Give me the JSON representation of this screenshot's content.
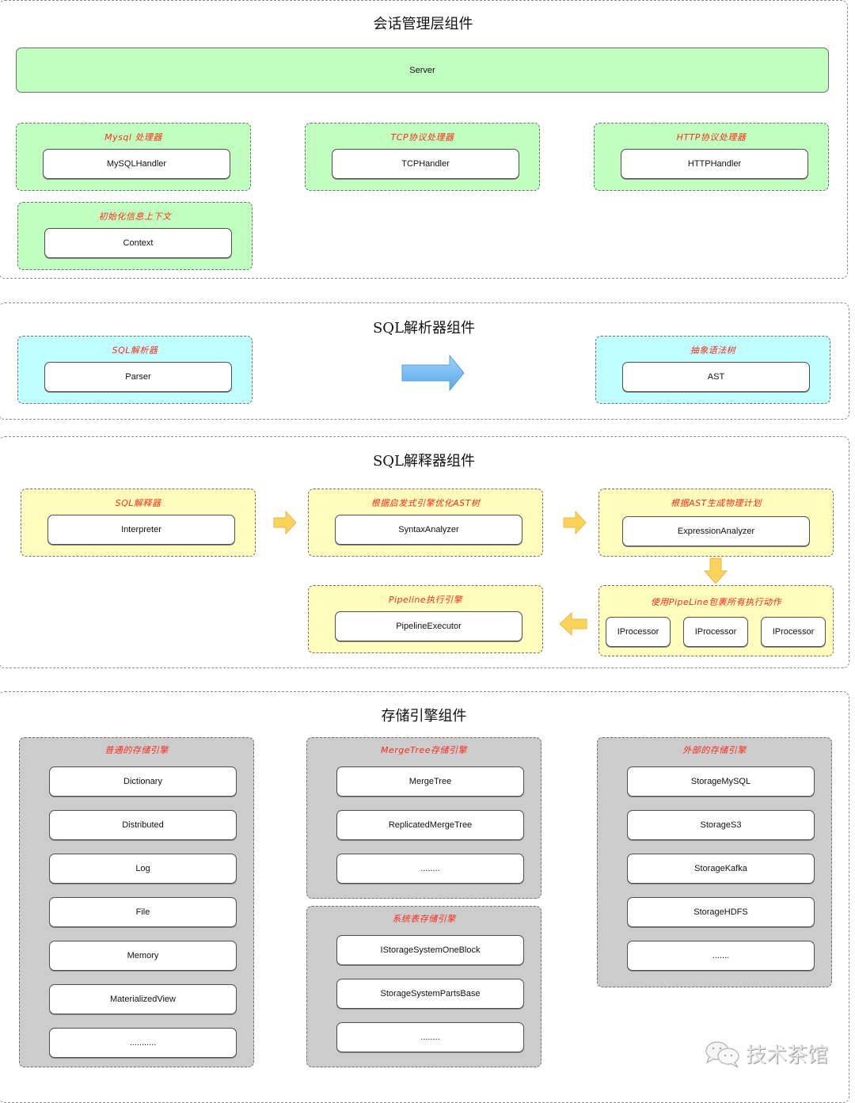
{
  "sections": {
    "session": {
      "title": "会话管理层组件",
      "server": "Server",
      "groups": [
        {
          "label": "Mysql 处理器",
          "node": "MySQLHandler"
        },
        {
          "label": "TCP协议处理器",
          "node": "TCPHandler"
        },
        {
          "label": "HTTP协议处理器",
          "node": "HTTPHandler"
        },
        {
          "label": "初始化信息上下文",
          "node": "Context"
        }
      ]
    },
    "parser": {
      "title": "SQL解析器组件",
      "groups": [
        {
          "label": "SQL解析器",
          "node": "Parser"
        },
        {
          "label": "抽象语法树",
          "node": "AST"
        }
      ]
    },
    "interpreter": {
      "title": "SQL解释器组件",
      "groups": [
        {
          "label": "SQL解释器",
          "node": "Interpreter"
        },
        {
          "label": "根据启发式引擎优化AST树",
          "node": "SyntaxAnalyzer"
        },
        {
          "label": "根据AST生成物理计划",
          "node": "ExpressionAnalyzer"
        },
        {
          "label": "Pipeline执行引擎",
          "node": "PipelineExecutor"
        },
        {
          "label": "使用PipeLine包裹所有执行动作",
          "nodes": [
            "IProcessor",
            "IProcessor",
            "IProcessor"
          ]
        }
      ]
    },
    "storage": {
      "title": "存储引擎组件",
      "groups": [
        {
          "label": "普通的存储引擎",
          "nodes": [
            "Dictionary",
            "Distributed",
            "Log",
            "File",
            "Memory",
            "MaterializedView",
            "..........."
          ]
        },
        {
          "label": "MergeTree存储引擎",
          "nodes": [
            "MergeTree",
            "ReplicatedMergeTree",
            "........"
          ]
        },
        {
          "label": "系统表存储引擎",
          "nodes": [
            "IStorageSystemOneBlock",
            "StorageSystemPartsBase",
            "........"
          ]
        },
        {
          "label": "外部的存储引擎",
          "nodes": [
            "StorageMySQL",
            "StorageS3",
            "StorageKafka",
            "StorageHDFS",
            "......."
          ]
        }
      ]
    }
  },
  "watermark": {
    "text": "技术茶馆",
    "icon": "wechat-icon"
  },
  "colors": {
    "green": "#c0ffc0",
    "cyan": "#c0ffff",
    "yellow": "#fffcbc",
    "gray": "#cccccc",
    "label_red": "#ff2a1a",
    "arrow_blue": "#6ab4ee",
    "arrow_yellow": "#fcd35a"
  }
}
